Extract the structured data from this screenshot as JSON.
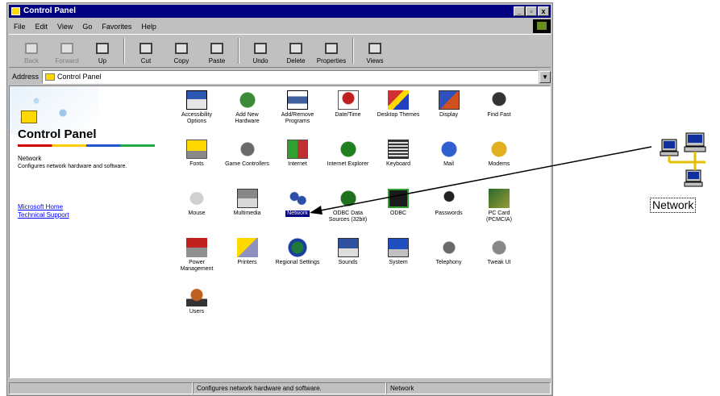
{
  "window": {
    "title": "Control Panel",
    "buttons": [
      "_",
      "▫",
      "x"
    ]
  },
  "menubar": {
    "items": [
      "File",
      "Edit",
      "View",
      "Go",
      "Favorites",
      "Help"
    ]
  },
  "toolbar": {
    "buttons": [
      {
        "label": "Back",
        "icon": "back-arrow-icon"
      },
      {
        "label": "Forward",
        "icon": "forward-arrow-icon"
      },
      {
        "label": "Up",
        "icon": "up-folder-icon"
      },
      {
        "label": "Cut",
        "icon": "cut-icon"
      },
      {
        "label": "Copy",
        "icon": "copy-icon"
      },
      {
        "label": "Paste",
        "icon": "paste-icon"
      },
      {
        "label": "Undo",
        "icon": "undo-icon"
      },
      {
        "label": "Delete",
        "icon": "delete-icon"
      },
      {
        "label": "Properties",
        "icon": "properties-icon"
      },
      {
        "label": "Views",
        "icon": "views-icon"
      }
    ]
  },
  "address": {
    "label": "Address",
    "value": "Control Panel"
  },
  "left_pane": {
    "title": "Control Panel",
    "selected_name": "Network",
    "selected_desc": "Configures network hardware and software.",
    "links": [
      "Microsoft Home",
      "Technical Support"
    ]
  },
  "icons": [
    {
      "label": "Accessibility Options"
    },
    {
      "label": "Add New Hardware"
    },
    {
      "label": "Add/Remove Programs"
    },
    {
      "label": "Date/Time"
    },
    {
      "label": "Desktop Themes"
    },
    {
      "label": "Display"
    },
    {
      "label": "Find Fast"
    },
    {
      "label": "Fonts"
    },
    {
      "label": "Game Controllers"
    },
    {
      "label": "Internet"
    },
    {
      "label": "Internet Explorer"
    },
    {
      "label": "Keyboard"
    },
    {
      "label": "Mail"
    },
    {
      "label": "Modems"
    },
    {
      "label": "Mouse"
    },
    {
      "label": "Multimedia"
    },
    {
      "label": "Network"
    },
    {
      "label": "ODBC Data Sources (32bit)"
    },
    {
      "label": "ODBC"
    },
    {
      "label": "Passwords"
    },
    {
      "label": "PC Card (PCMCIA)"
    },
    {
      "label": "Power Management"
    },
    {
      "label": "Printers"
    },
    {
      "label": "Regional Settings"
    },
    {
      "label": "Sounds"
    },
    {
      "label": "System"
    },
    {
      "label": "Telephony"
    },
    {
      "label": "Tweak UI"
    },
    {
      "label": "Users"
    }
  ],
  "statusbar": {
    "cell1": "",
    "cell2": "Configures network hardware and software.",
    "cell3": "Network"
  },
  "callout": {
    "label": "Network"
  }
}
